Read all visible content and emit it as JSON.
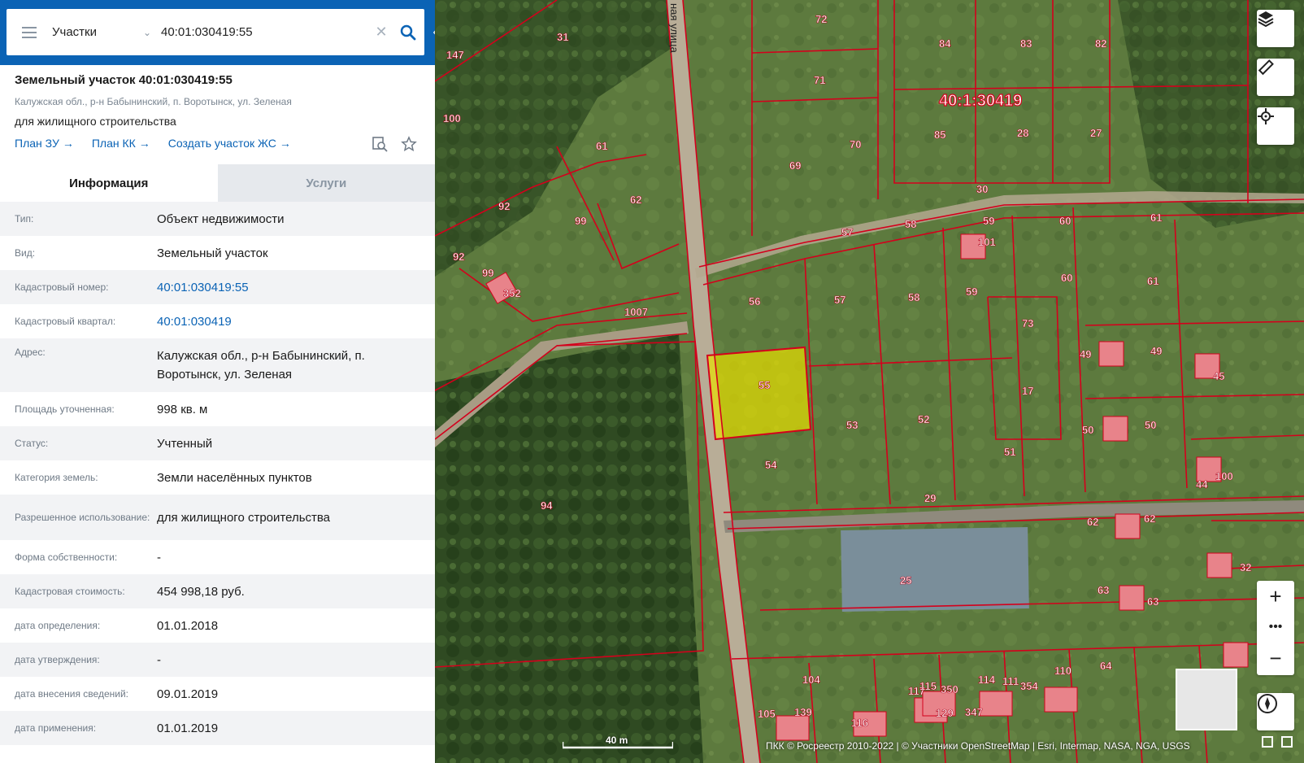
{
  "search": {
    "layer": "Участки",
    "query": "40:01:030419:55"
  },
  "object": {
    "title": "Земельный участок 40:01:030419:55",
    "address": "Калужская обл., р-н Бабынинский, п. Воротынск, ул. Зеленая",
    "purpose": "для жилищного строительства",
    "links": [
      "План ЗУ",
      "План КК",
      "Создать участок ЖС"
    ]
  },
  "tabs": {
    "info": "Информация",
    "services": "Услуги"
  },
  "info": [
    {
      "key": "Тип:",
      "value": "Объект недвижимости"
    },
    {
      "key": "Вид:",
      "value": "Земельный участок"
    },
    {
      "key": "Кадастровый номер:",
      "value": "40:01:030419:55"
    },
    {
      "key": "Кадастровый квартал:",
      "value": "40:01:030419"
    },
    {
      "key": "Адрес:",
      "value": "Калужская обл., р-н Бабынинский, п. Воротынск, ул. Зеленая"
    },
    {
      "key": "Площадь уточненная:",
      "value": "998 кв. м"
    },
    {
      "key": "Статус:",
      "value": "Учтенный"
    },
    {
      "key": "Категория земель:",
      "value": "Земли населённых пунктов"
    },
    {
      "key": "Разрешенное использование:",
      "value": "для жилищного строительства"
    },
    {
      "key": "Форма собственности:",
      "value": "-"
    },
    {
      "key": "Кадастровая стоимость:",
      "value": "454 998,18 руб."
    },
    {
      "key": "дата определения:",
      "value": "01.01.2018"
    },
    {
      "key": "дата утверждения:",
      "value": "-"
    },
    {
      "key": "дата внесения сведений:",
      "value": "09.01.2019"
    },
    {
      "key": "дата применения:",
      "value": "01.01.2019"
    }
  ],
  "map": {
    "quarter_label": "40:1:30419",
    "street_label": "ная улица",
    "scale_label": "40 m",
    "attribution": "ПКК © Росреестр 2010-2022 | © Участники OpenStreetMap | Esri, Intermap, NASA, NGA, USGS",
    "parcel_labels": [
      "72",
      "84",
      "83",
      "82",
      "71",
      "70",
      "69",
      "85",
      "28",
      "27",
      "30",
      "31",
      "147",
      "100",
      "61",
      "62",
      "92",
      "99",
      "92",
      "99",
      "352",
      "1007",
      "57",
      "58",
      "59",
      "101",
      "60",
      "61",
      "56",
      "57",
      "58",
      "59",
      "60",
      "61",
      "73",
      "49",
      "49",
      "45",
      "55",
      "53",
      "52",
      "17",
      "50",
      "50",
      "51",
      "54",
      "29",
      "94",
      "100",
      "44",
      "25",
      "62",
      "62",
      "63",
      "63",
      "104",
      "117",
      "115",
      "350",
      "114",
      "111",
      "354",
      "110",
      "64",
      "105",
      "139",
      "116",
      "129",
      "347",
      "32"
    ],
    "highlight_color": "#e8e000",
    "boundary_color": "#d4001c"
  }
}
